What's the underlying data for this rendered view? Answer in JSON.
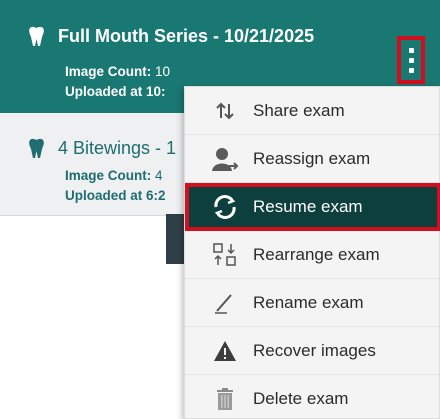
{
  "colors": {
    "teal": "#1a7873",
    "menu_active": "#0d3f3c",
    "highlight_red": "#d10f20"
  },
  "exams": [
    {
      "title": "Full Mouth Series - 10/21/2025",
      "image_count_label": "Image Count:",
      "image_count": "10",
      "uploaded_label": "Uploaded",
      "uploaded_value": "at 10:",
      "icon": "tooth-icon"
    },
    {
      "title": "4 Bitewings - 1",
      "image_count_label": "Image Count:",
      "image_count": "4",
      "uploaded_label": "Uploaded",
      "uploaded_value": "at 6:2",
      "icon": "tooth-icon"
    }
  ],
  "menu": {
    "items": [
      {
        "label": "Share exam",
        "icon": "share-icon"
      },
      {
        "label": "Reassign exam",
        "icon": "reassign-icon"
      },
      {
        "label": "Resume exam",
        "icon": "resume-icon"
      },
      {
        "label": "Rearrange exam",
        "icon": "rearrange-icon"
      },
      {
        "label": "Rename exam",
        "icon": "rename-icon"
      },
      {
        "label": "Recover images",
        "icon": "warning-icon"
      },
      {
        "label": "Delete exam",
        "icon": "trash-icon"
      }
    ]
  }
}
